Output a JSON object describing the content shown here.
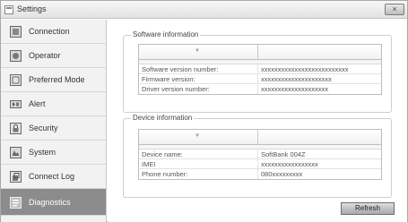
{
  "window": {
    "title": "Settings",
    "close_glyph": "×"
  },
  "sidebar": {
    "items": [
      {
        "label": "Connection",
        "icon": "connection-icon",
        "active": false
      },
      {
        "label": "Operator",
        "icon": "operator-icon",
        "active": false
      },
      {
        "label": "Preferred Mode",
        "icon": "preferred-mode-icon",
        "active": false
      },
      {
        "label": "Alert",
        "icon": "alert-icon",
        "active": false
      },
      {
        "label": "Security",
        "icon": "security-icon",
        "active": false
      },
      {
        "label": "System",
        "icon": "system-icon",
        "active": false
      },
      {
        "label": "Connect Log",
        "icon": "connect-log-icon",
        "active": false
      },
      {
        "label": "Diagnostics",
        "icon": "diagnostics-icon",
        "active": true
      }
    ]
  },
  "software": {
    "legend": "Software information",
    "sort_glyph": "▼",
    "rows": [
      {
        "name": "Software version number:",
        "value": "xxxxxxxxxxxxxxxxxxxxxxxxxx"
      },
      {
        "name": "Firmware version:",
        "value": "xxxxxxxxxxxxxxxxxxxxx"
      },
      {
        "name": "Driver version number:",
        "value": "xxxxxxxxxxxxxxxxxxxx"
      }
    ]
  },
  "device": {
    "legend": "Device information",
    "sort_glyph": "▼",
    "rows": [
      {
        "name": "Device name:",
        "value": "SoftBank 004Z"
      },
      {
        "name": "IMEI",
        "value": "xxxxxxxxxxxxxxxxx"
      },
      {
        "name": "Phone number:",
        "value": "080xxxxxxxxx"
      }
    ]
  },
  "actions": {
    "refresh_label": "Refresh"
  },
  "colors": {
    "active_item": "#8c8c8c",
    "sidebar_bg": "#f2f2f2",
    "button_gradient_bottom": "#a9a9a9"
  }
}
